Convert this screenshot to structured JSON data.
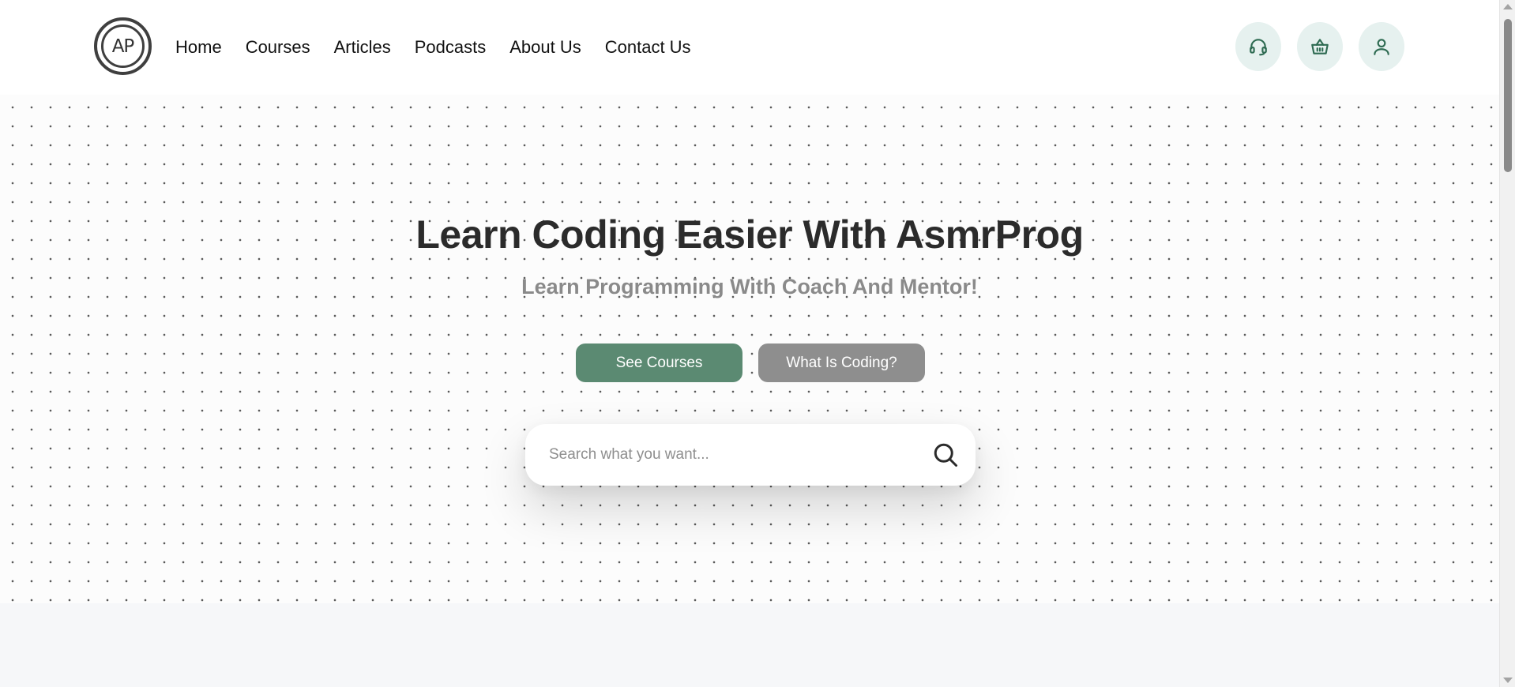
{
  "header": {
    "logo_text": "AP",
    "nav": [
      "Home",
      "Courses",
      "Articles",
      "Podcasts",
      "About Us",
      "Contact Us"
    ],
    "icons": [
      "headset-icon",
      "basket-icon",
      "user-icon"
    ],
    "icon_color": "#2e6b52"
  },
  "hero": {
    "title": "Learn Coding Easier With AsmrProg",
    "subtitle": "Learn Programming With Coach And Mentor!",
    "primary_button": "See Courses",
    "secondary_button": "What Is Coding?",
    "search_placeholder": "Search what you want..."
  },
  "colors": {
    "primary": "#5b8a72",
    "secondary": "#8e8e8e",
    "icon_bg": "#e6f1ef"
  }
}
